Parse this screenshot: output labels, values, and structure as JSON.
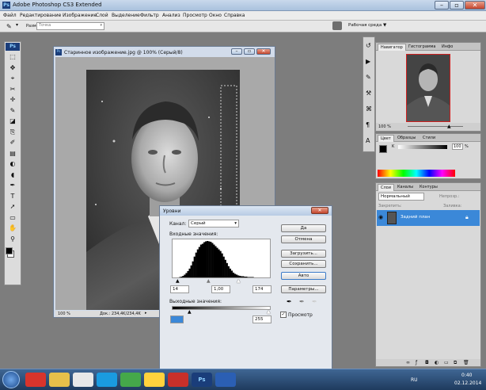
{
  "app": {
    "title": "Adobe Photoshop CS3 Extended"
  },
  "menu": [
    "Файл",
    "Редактирование",
    "Изображение",
    "Слой",
    "Выделение",
    "Фильтр",
    "Анализ",
    "Просмотр",
    "Окно",
    "Справка"
  ],
  "options": {
    "sample_label": "Размер образца:",
    "sample_value": "Точка",
    "workspace": "Рабочая среда ▼"
  },
  "ps_badge": "Ps",
  "document": {
    "title": "Старинное изображение.jpg @ 100% (Серый/8)",
    "zoom": "100 %",
    "doc_size": "Док.: 234,4K/234,4K"
  },
  "levels": {
    "title": "Уровни",
    "channel_label": "Канал:",
    "channel_value": "Серый",
    "input_label": "Входные значения:",
    "input_values": [
      "14",
      "1,00",
      "174"
    ],
    "output_label": "Выходные значения:",
    "output_values": [
      "",
      "255"
    ],
    "buttons": [
      "Да",
      "Отмена",
      "Загрузить...",
      "Сохранить...",
      "Авто",
      "Параметры..."
    ],
    "preview_label": "Просмотр",
    "preview_checked": true,
    "histogram": [
      0,
      0,
      0,
      0,
      1,
      2,
      4,
      7,
      11,
      16,
      22,
      30,
      40,
      52,
      62,
      70,
      76,
      82,
      84,
      88,
      90,
      91,
      90,
      89,
      86,
      82,
      78,
      74,
      70,
      66,
      60,
      52,
      44,
      36,
      28,
      22,
      17,
      12,
      9,
      7,
      5,
      4,
      3,
      3,
      2,
      2,
      1,
      1,
      1,
      1,
      0,
      0,
      0,
      0,
      0,
      0,
      0,
      0,
      0,
      0
    ]
  },
  "navigator": {
    "tabs": [
      "Навигатор",
      "Гистограмма",
      "Инфо"
    ],
    "zoom": "100 %"
  },
  "color": {
    "tabs": [
      "Цвет",
      "Образцы",
      "Стили"
    ],
    "k_label": "K",
    "k_value": "100",
    "k_unit": "%"
  },
  "layers": {
    "tabs": [
      "Слои",
      "Каналы",
      "Контуры"
    ],
    "blend_mode": "Нормальный",
    "opacity_label": "Непрозр.:",
    "lock_label": "Закрепить:",
    "fill_label": "Заливка:",
    "layer_name": "Задний план"
  },
  "taskbar": {
    "lang": "RU",
    "time": "0:40",
    "date": "02.12.2014",
    "ps_label": "Ps"
  }
}
